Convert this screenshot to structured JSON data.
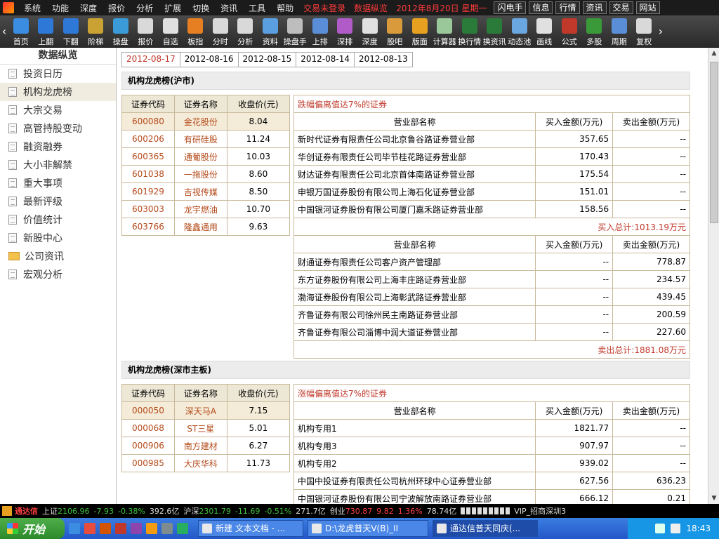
{
  "menubar": {
    "items": [
      "系统",
      "功能",
      "深度",
      "报价",
      "分析",
      "扩展",
      "切换",
      "资讯",
      "工具",
      "帮助"
    ],
    "status_red": [
      "交易未登录",
      "数据纵览",
      "2012年8月20日  星期一"
    ],
    "right_buttons": [
      "闪电手",
      "信息",
      "行情",
      "资讯",
      "交易",
      "网站"
    ]
  },
  "toolbar": {
    "buttons": [
      {
        "label": "首页",
        "icon": "home-icon",
        "color": "#3a8de0"
      },
      {
        "label": "上翻",
        "icon": "arrow-up-icon",
        "color": "#2e78d8"
      },
      {
        "label": "下翻",
        "icon": "arrow-down-icon",
        "color": "#2e78d8"
      },
      {
        "label": "阶梯",
        "icon": "ladder-icon",
        "color": "#c9a233"
      },
      {
        "label": "操盘",
        "icon": "trade-panel-icon",
        "color": "#3a9bd8"
      },
      {
        "label": "报价",
        "icon": "yen-icon",
        "color": "#d9d9d9"
      },
      {
        "label": "自选",
        "icon": "f6-icon",
        "color": "#e0e0e0"
      },
      {
        "label": "板指",
        "icon": "sector-index-icon",
        "color": "#e67e22"
      },
      {
        "label": "分时",
        "icon": "intraday-chart-icon",
        "color": "#d9d9d9"
      },
      {
        "label": "分析",
        "icon": "analysis-chart-icon",
        "color": "#d9d9d9"
      },
      {
        "label": "资料",
        "icon": "document-icon",
        "color": "#5aa0e0"
      },
      {
        "label": "操盘手",
        "icon": "f10-icon",
        "color": "#bdbdbd"
      },
      {
        "label": "上排",
        "icon": "rank-up-icon",
        "color": "#5a8fd8"
      },
      {
        "label": "深排",
        "icon": "rank-sz-icon",
        "color": "#b05bc8"
      },
      {
        "label": "深度",
        "icon": "f9-icon",
        "color": "#e0e0e0"
      },
      {
        "label": "股吧",
        "icon": "community-icon",
        "color": "#d89a3a"
      },
      {
        "label": "版面",
        "icon": "l2-icon",
        "color": "#e8a020"
      },
      {
        "label": "计算器",
        "icon": "calculator-icon",
        "color": "#9bc89b"
      },
      {
        "label": "换行情",
        "icon": "switch-quote-icon",
        "color": "#2a7a3a"
      },
      {
        "label": "换资讯",
        "icon": "switch-news-icon",
        "color": "#2a7a3a"
      },
      {
        "label": "动态池",
        "icon": "dynamic-pool-icon",
        "color": "#6aa6e0"
      },
      {
        "label": "画线",
        "icon": "draw-line-icon",
        "color": "#e0e0e0"
      },
      {
        "label": "公式",
        "icon": "formula-icon",
        "color": "#c0392b"
      },
      {
        "label": "多股",
        "icon": "multi-stock-icon",
        "color": "#3a9a3a"
      },
      {
        "label": "周期",
        "icon": "period-icon",
        "color": "#5a8fd8"
      },
      {
        "label": "复权",
        "icon": "adjust-icon",
        "color": "#d9d9d9"
      }
    ]
  },
  "sidebar": {
    "title": "数据纵览",
    "items": [
      {
        "label": "投资日历",
        "icon": "document-icon"
      },
      {
        "label": "机构龙虎榜",
        "icon": "document-icon"
      },
      {
        "label": "大宗交易",
        "icon": "document-icon"
      },
      {
        "label": "高管持股变动",
        "icon": "document-icon"
      },
      {
        "label": "融资融券",
        "icon": "document-icon"
      },
      {
        "label": "大小非解禁",
        "icon": "document-icon"
      },
      {
        "label": "重大事项",
        "icon": "document-icon"
      },
      {
        "label": "最新评级",
        "icon": "document-icon"
      },
      {
        "label": "价值统计",
        "icon": "document-icon"
      },
      {
        "label": "新股中心",
        "icon": "document-icon"
      },
      {
        "label": "公司资讯",
        "icon": "folder-icon"
      },
      {
        "label": "宏观分析",
        "icon": "document-icon"
      }
    ]
  },
  "date_tabs": [
    "2012-08-17",
    "2012-08-16",
    "2012-08-15",
    "2012-08-14",
    "2012-08-13"
  ],
  "section1": {
    "title": "机构龙虎榜(沪市)",
    "stock_headers": [
      "证券代码",
      "证券名称",
      "收盘价(元)"
    ],
    "stocks": [
      [
        "600080",
        "金花股份",
        "8.04"
      ],
      [
        "600206",
        "有研硅股",
        "11.24"
      ],
      [
        "600365",
        "通葡股份",
        "10.03"
      ],
      [
        "601038",
        "一拖股份",
        "8.60"
      ],
      [
        "601929",
        "吉视传媒",
        "8.50"
      ],
      [
        "603003",
        "龙宇燃油",
        "10.70"
      ],
      [
        "603766",
        "隆鑫通用",
        "9.63"
      ]
    ],
    "caption": "跌幅偏离值达7%的证券",
    "broker_headers": [
      "营业部名称",
      "买入金额(万元)",
      "卖出金额(万元)"
    ],
    "buy_rows": [
      [
        "新时代证券有限责任公司北京鲁谷路证券营业部",
        "357.65",
        "--"
      ],
      [
        "华创证券有限责任公司毕节桂花路证券营业部",
        "170.43",
        "--"
      ],
      [
        "财达证券有限责任公司北京首体南路证券营业部",
        "175.54",
        "--"
      ],
      [
        "申银万国证券股份有限公司上海石化证券营业部",
        "151.01",
        "--"
      ],
      [
        "中国银河证券股份有限公司厦门嘉禾路证券营业部",
        "158.56",
        "--"
      ]
    ],
    "buy_total": "买入总计:1013.19万元",
    "sell_rows": [
      [
        "财通证券有限责任公司客户资产管理部",
        "--",
        "778.87"
      ],
      [
        "东方证券股份有限公司上海丰庄路证券营业部",
        "--",
        "234.57"
      ],
      [
        "渤海证券股份有限公司上海彰武路证券营业部",
        "--",
        "439.45"
      ],
      [
        "齐鲁证券有限公司徐州民主南路证券营业部",
        "--",
        "200.59"
      ],
      [
        "齐鲁证券有限公司淄博中润大道证券营业部",
        "--",
        "227.60"
      ]
    ],
    "sell_total": "卖出总计:1881.08万元"
  },
  "section2": {
    "title": "机构龙虎榜(深市主板)",
    "stock_headers": [
      "证券代码",
      "证券名称",
      "收盘价(元)"
    ],
    "stocks": [
      [
        "000050",
        "深天马A",
        "7.15"
      ],
      [
        "000068",
        "ST三星",
        "5.01"
      ],
      [
        "000906",
        "南方建材",
        "6.27"
      ],
      [
        "000985",
        "大庆华科",
        "11.73"
      ]
    ],
    "caption": "涨幅偏离值达7%的证券",
    "broker_headers": [
      "营业部名称",
      "买入金额(万元)",
      "卖出金额(万元)"
    ],
    "rows": [
      [
        "机构专用1",
        "1821.77",
        "--"
      ],
      [
        "机构专用3",
        "907.97",
        "--"
      ],
      [
        "机构专用2",
        "939.02",
        "--"
      ],
      [
        "中国中投证券有限责任公司杭州环球中心证券营业部",
        "627.56",
        "636.23"
      ],
      [
        "中国银河证券股份有限公司宁波解放南路证券营业部",
        "666.12",
        "0.21"
      ]
    ]
  },
  "statusbar": {
    "brand": "通达信",
    "sh_label": "上证",
    "sh_value": "2106.96",
    "sh_change": "-7.93",
    "sh_pct": "-0.38%",
    "sh_amount": "392.6亿",
    "sz_label": "沪深",
    "sz_value": "2301.79",
    "sz_change": "-11.69",
    "sz_pct": "-0.51%",
    "sz_amount": "271.7亿",
    "cy_label": "创业",
    "cy_value": "730.87",
    "cy_change": "9.82",
    "cy_pct": "1.36%",
    "cy_amount": "78.74亿",
    "server": "VIP_招商深圳3"
  },
  "taskbar": {
    "start": "开始",
    "tasks": [
      "新建 文本文档 - ...",
      "D:\\龙虎普天V(B)_II",
      "通达信普天同庆(..."
    ],
    "clock": "18:43"
  }
}
